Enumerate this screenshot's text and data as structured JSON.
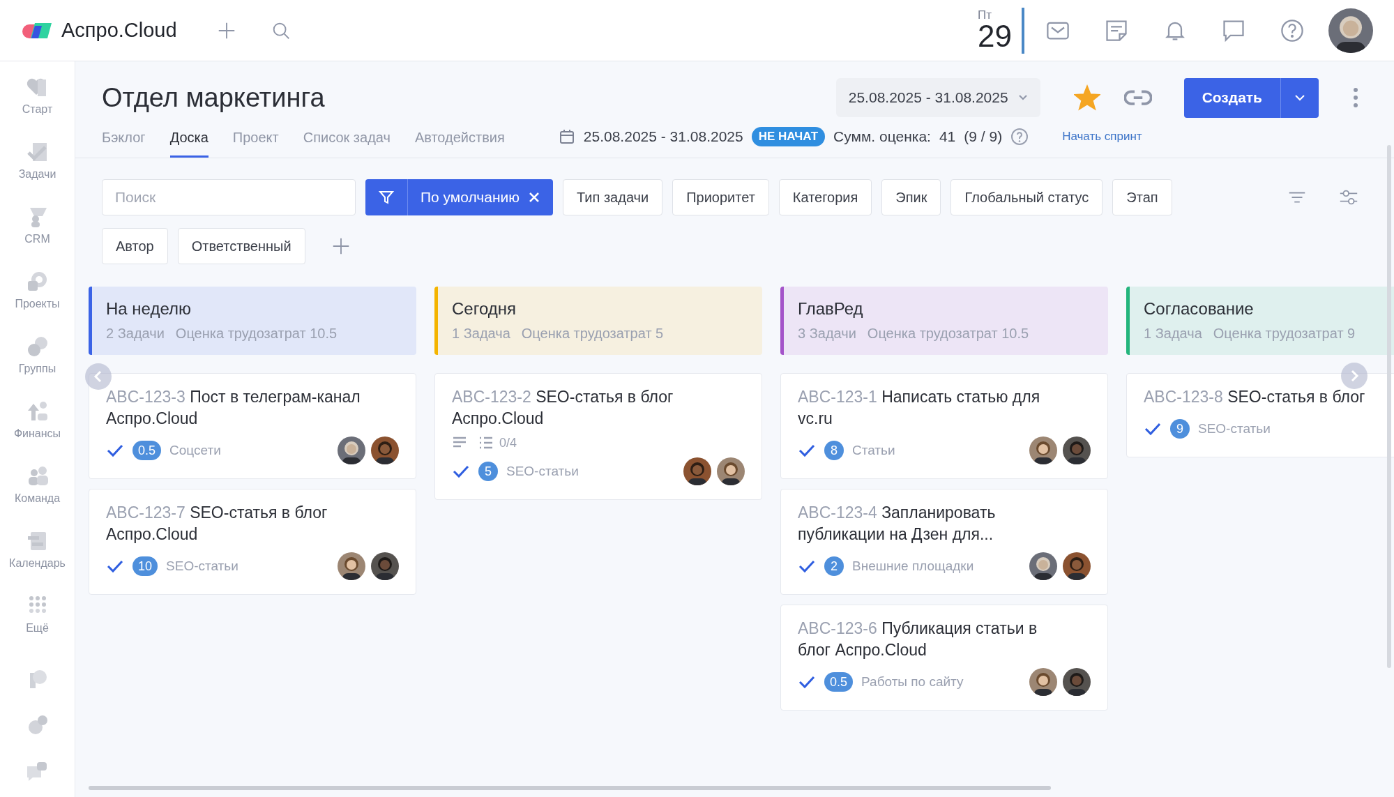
{
  "app": {
    "name": "Аспро.Cloud"
  },
  "topbar": {
    "weekday": "Пт",
    "day": "29"
  },
  "sidebar": {
    "items": [
      {
        "label": "Старт",
        "selected": false
      },
      {
        "label": "Задачи",
        "selected": false
      },
      {
        "label": "CRM",
        "selected": false
      },
      {
        "label": "Проекты",
        "selected": false
      },
      {
        "label": "Группы",
        "selected": false
      },
      {
        "label": "Финансы",
        "selected": false
      },
      {
        "label": "Команда",
        "selected": false
      },
      {
        "label": "Календарь",
        "selected": false
      },
      {
        "label": "Ещё",
        "selected": false
      }
    ]
  },
  "header": {
    "title": "Отдел маркетинга",
    "period": "25.08.2025 - 31.08.2025",
    "favorite": true,
    "create_button": "Создать",
    "tabs": [
      {
        "label": "Бэклог",
        "selected": false
      },
      {
        "label": "Доска",
        "selected": true
      },
      {
        "label": "Проект",
        "selected": false
      },
      {
        "label": "Список задач",
        "selected": false
      },
      {
        "label": "Автодействия",
        "selected": false
      }
    ],
    "sprint": {
      "dates": "25.08.2025 - 31.08.2025",
      "status": "НЕ НАЧАТ",
      "estimate_label": "Сумм. оценка:",
      "estimate_value": "41",
      "estimate_count": "(9 / 9)",
      "start_link": "Начать спринт"
    }
  },
  "filters": {
    "search": {
      "placeholder": "Поиск"
    },
    "preset": "По умолчанию",
    "chips": [
      "Тип задачи",
      "Приоритет",
      "Категория",
      "Эпик",
      "Глобальный статус",
      "Этап",
      "Автор",
      "Ответственный"
    ]
  },
  "columns": [
    {
      "title": "На неделю",
      "count": "2 Задачи",
      "estimate": "Оценка трудозатрат 10.5",
      "color": "#3b63e6",
      "cards": [
        {
          "key": "ABC-123-3",
          "title": "Пост в телеграм-канал Аспро.Cloud",
          "estimate": "0.5",
          "category": "Соцсети",
          "done": true
        },
        {
          "key": "ABC-123-7",
          "title": "SEO-статья в блог Аспро.Cloud",
          "estimate": "10",
          "category": "SEO-статьи",
          "done": true
        }
      ]
    },
    {
      "title": "Сегодня",
      "count": "1 Задача",
      "estimate": "Оценка трудозатрат 5",
      "color": "#f4b400",
      "cards": [
        {
          "key": "ABC-123-2",
          "title": "SEO-статья в блог Аспро.Cloud",
          "estimate": "5",
          "category": "SEO-статьи",
          "done": true,
          "details": {
            "description": true,
            "checklist": "0/4"
          }
        }
      ]
    },
    {
      "title": "ГлавРед",
      "count": "3 Задачи",
      "estimate": "Оценка трудозатрат 10.5",
      "color": "#a453c9",
      "cards": [
        {
          "key": "ABC-123-1",
          "title": "Написать статью для vc.ru",
          "estimate": "8",
          "category": "Статьи",
          "done": true
        },
        {
          "key": "ABC-123-4",
          "title": "Запланировать публикации на Дзен для...",
          "estimate": "2",
          "category": "Внешние площадки",
          "done": true
        },
        {
          "key": "ABC-123-6",
          "title": "Публикация статьи в блог Аспро.Cloud",
          "estimate": "0.5",
          "category": "Работы по сайту",
          "done": true
        }
      ]
    },
    {
      "title": "Согласование",
      "count": "1 Задача",
      "estimate": "Оценка трудозатрат 9",
      "color": "#24b57c",
      "cards": [
        {
          "key": "ABC-123-8",
          "title": "SEO-статья в блог",
          "estimate": "9",
          "category": "SEO-статьи",
          "done": true
        }
      ]
    }
  ]
}
